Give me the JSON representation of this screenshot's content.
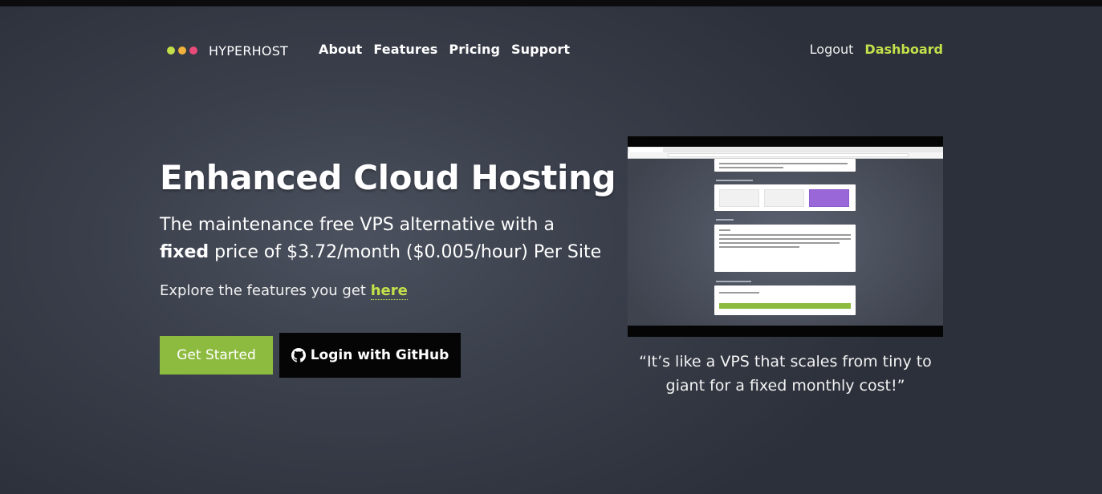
{
  "brand": {
    "name": "HYPERHOST",
    "dots": [
      "#c3e04a",
      "#f0b23a",
      "#e84a7a"
    ]
  },
  "nav": {
    "links": [
      "About",
      "Features",
      "Pricing",
      "Support"
    ],
    "logout": "Logout",
    "dashboard": "Dashboard"
  },
  "hero": {
    "title": "Enhanced Cloud Hosting",
    "subtitle_before": "The maintenance free VPS alternative with a ",
    "subtitle_bold": "fixed",
    "subtitle_after": " price of $3.72/month ($0.005/hour) Per Site",
    "explore_text": "Explore the features you get ",
    "explore_link": "here"
  },
  "buttons": {
    "get_started": "Get Started",
    "github": "Login with GitHub",
    "github_icon": "github-icon"
  },
  "quote": "“It’s like a VPS that scales from tiny to giant for a fixed monthly cost!”",
  "colors": {
    "accent": "#c3e04a",
    "button_green": "#8dbb3f",
    "github_bg": "#050505",
    "selected_option": "#9a67d8"
  }
}
